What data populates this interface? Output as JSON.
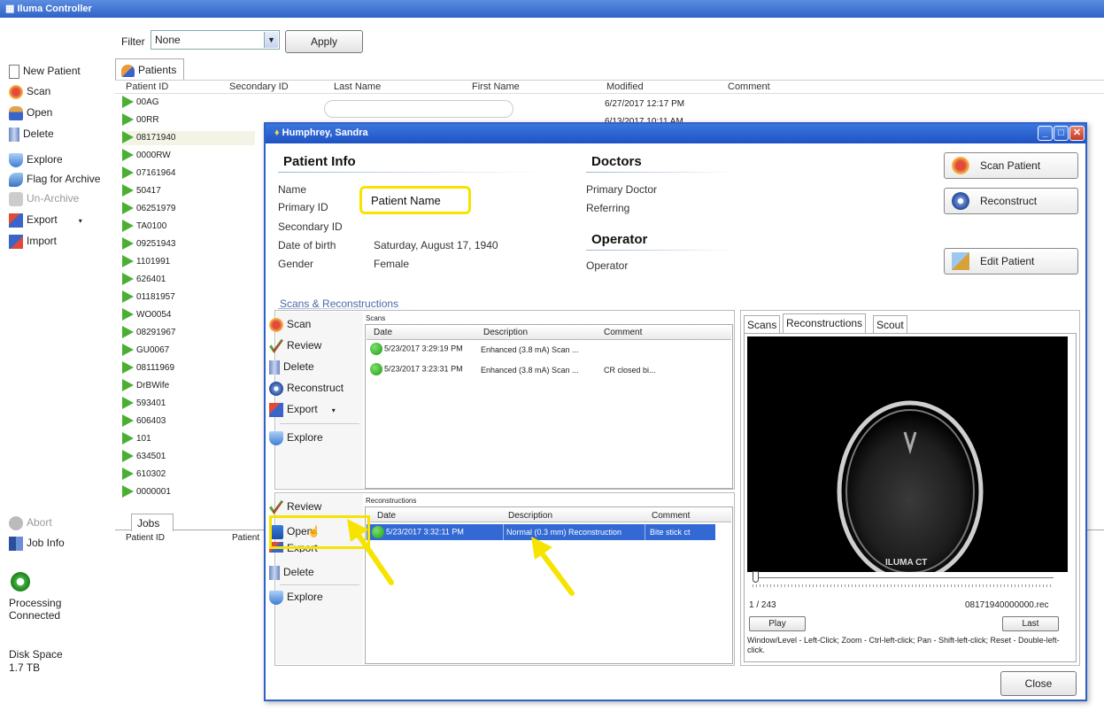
{
  "app": {
    "title": "Iluma Controller"
  },
  "sidebar": {
    "items": [
      {
        "label": "New Patient",
        "icon": "new-document-icon",
        "enabled": true
      },
      {
        "label": "Scan",
        "icon": "scan-icon",
        "enabled": true
      },
      {
        "label": "Open",
        "icon": "open-person-icon",
        "enabled": true
      },
      {
        "label": "Delete",
        "icon": "trash-icon",
        "enabled": true
      },
      {
        "label": "Explore",
        "icon": "explore-shield-icon",
        "enabled": true
      },
      {
        "label": "Flag for Archive",
        "icon": "flag-archive-icon",
        "enabled": true
      },
      {
        "label": "Un-Archive",
        "icon": "unarchive-icon",
        "enabled": false
      },
      {
        "label": "Export",
        "icon": "export-icon",
        "enabled": true
      },
      {
        "label": "Import",
        "icon": "import-icon",
        "enabled": true
      }
    ],
    "abort_label": "Abort",
    "job_info_label": "Job Info",
    "status_line1": "Processing",
    "status_line2": "Connected",
    "disk_label": "Disk Space",
    "disk_value": "1.7 TB"
  },
  "filter": {
    "label": "Filter",
    "value": "None",
    "apply_label": "Apply"
  },
  "patients": {
    "tab_label": "Patients",
    "columns": [
      "Patient ID",
      "Secondary ID",
      "Last Name",
      "First Name",
      "Modified",
      "Comment"
    ],
    "rows": [
      "00AG",
      "00RR",
      "08171940",
      "0000RW",
      "07161964",
      "50417",
      "06251979",
      "TA0100",
      "09251943",
      "1101991",
      "626401",
      "01181957",
      "WO0054",
      "08291967",
      "GU0067",
      "08111969",
      "DrBWife",
      "593401",
      "606403",
      "101",
      "634501",
      "610302",
      "0000001"
    ],
    "modified": [
      "6/27/2017 12:17 PM",
      "6/13/2017 10:11 AM"
    ]
  },
  "jobs": {
    "tab_label": "Jobs",
    "columns": [
      "Patient ID",
      "Patient"
    ]
  },
  "dialog": {
    "title": "Humphrey, Sandra",
    "patient_info": {
      "heading": "Patient Info",
      "name_label": "Name",
      "name_value": "Patient Name",
      "pid_label": "Primary ID",
      "sid_label": "Secondary ID",
      "dob_label": "Date of birth",
      "dob_value": "Saturday, August 17, 1940",
      "gender_label": "Gender",
      "gender_value": "Female"
    },
    "doctors": {
      "heading": "Doctors",
      "primary_label": "Primary Doctor",
      "referring_label": "Referring"
    },
    "operator": {
      "heading": "Operator",
      "label": "Operator"
    },
    "buttons": {
      "scan_patient": "Scan Patient",
      "reconstruct": "Reconstruct",
      "edit_patient": "Edit Patient",
      "close": "Close"
    },
    "scans_recons_label": "Scans & Reconstructions",
    "scan_actions": [
      "Scan",
      "Review",
      "Delete",
      "Reconstruct",
      "Export",
      "Explore"
    ],
    "scans": {
      "label": "Scans",
      "columns": [
        "Date",
        "Description",
        "Comment"
      ],
      "rows": [
        {
          "date": "5/23/2017 3:29:19 PM",
          "description": "Enhanced (3.8 mA) Scan ...",
          "comment": ""
        },
        {
          "date": "5/23/2017 3:23:31 PM",
          "description": "Enhanced (3.8 mA) Scan ...",
          "comment": "CR closed bi..."
        }
      ]
    },
    "recon_actions": [
      "Review",
      "Open",
      "Export",
      "Delete",
      "Explore"
    ],
    "reconstructions": {
      "label": "Reconstructions",
      "columns": [
        "Date",
        "Description",
        "Comment"
      ],
      "rows": [
        {
          "date": "5/23/2017 3:32:11 PM",
          "description": "Normal (0.3 mm) Reconstruction",
          "comment": "Bite stick ct"
        }
      ]
    },
    "viewer": {
      "tabs": [
        "Scans",
        "Reconstructions",
        "Scout"
      ],
      "watermark": "ILUMA CT",
      "slice": "1 / 243",
      "filename": "08171940000000.rec",
      "play_label": "Play",
      "last_label": "Last",
      "help": "Window/Level - Left-Click;  Zoom - Ctrl-left-click; Pan - Shift-left-click; Reset - Double-left-click."
    }
  },
  "colors": {
    "titlebar": "#2f62c8",
    "selection": "#3269d4",
    "highlight": "#f6e400",
    "status_green": "#3cb23a"
  }
}
